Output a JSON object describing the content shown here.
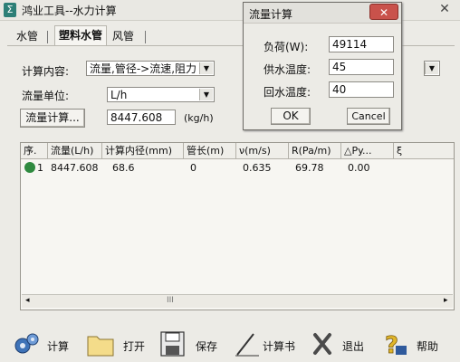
{
  "main": {
    "title": "鸿业工具--水力计算",
    "app_icon": "Σ",
    "close": "✕",
    "tabs": [
      {
        "label": "水管"
      },
      {
        "label": "塑料水管"
      },
      {
        "label": "风管"
      }
    ]
  },
  "form": {
    "calc_content_label": "计算内容:",
    "calc_content_value": "流量,管径->流速,阻力",
    "flow_unit_label": "流量单位:",
    "flow_unit_value": "L/h",
    "flow_calc_button": "流量计算...",
    "flow_value": "8447.608",
    "flow_value_unit": "(kg/h)"
  },
  "table": {
    "columns": [
      "序.",
      "流量(L/h)",
      "计算内径(mm)",
      "管长(m)",
      "ν(m/s)",
      "R(Pa/m)",
      "△Py...",
      "ξ"
    ],
    "rows": [
      [
        "1",
        "8447.608",
        "68.6",
        "0",
        "0.635",
        "69.78",
        "0.00",
        ""
      ]
    ],
    "scroll_thumb_mark": "III",
    "scroll_left": "◂",
    "scroll_right": "▸"
  },
  "toolbar": {
    "calculate": "计算",
    "open": "打开",
    "save": "保存",
    "report": "计算书",
    "exit": "退出",
    "help": "帮助"
  },
  "dialog": {
    "title": "流量计算",
    "close": "✕",
    "load_label": "负荷(W):",
    "load_value": "49114",
    "supply_temp_label": "供水温度:",
    "supply_temp_value": "45",
    "return_temp_label": "回水温度:",
    "return_temp_value": "40",
    "ok": "OK",
    "cancel": "Cancel"
  },
  "colors": {
    "window_bg": "#ecebe6",
    "dialog_close": "#c9524b",
    "row_icon": "#2f8a3f"
  }
}
